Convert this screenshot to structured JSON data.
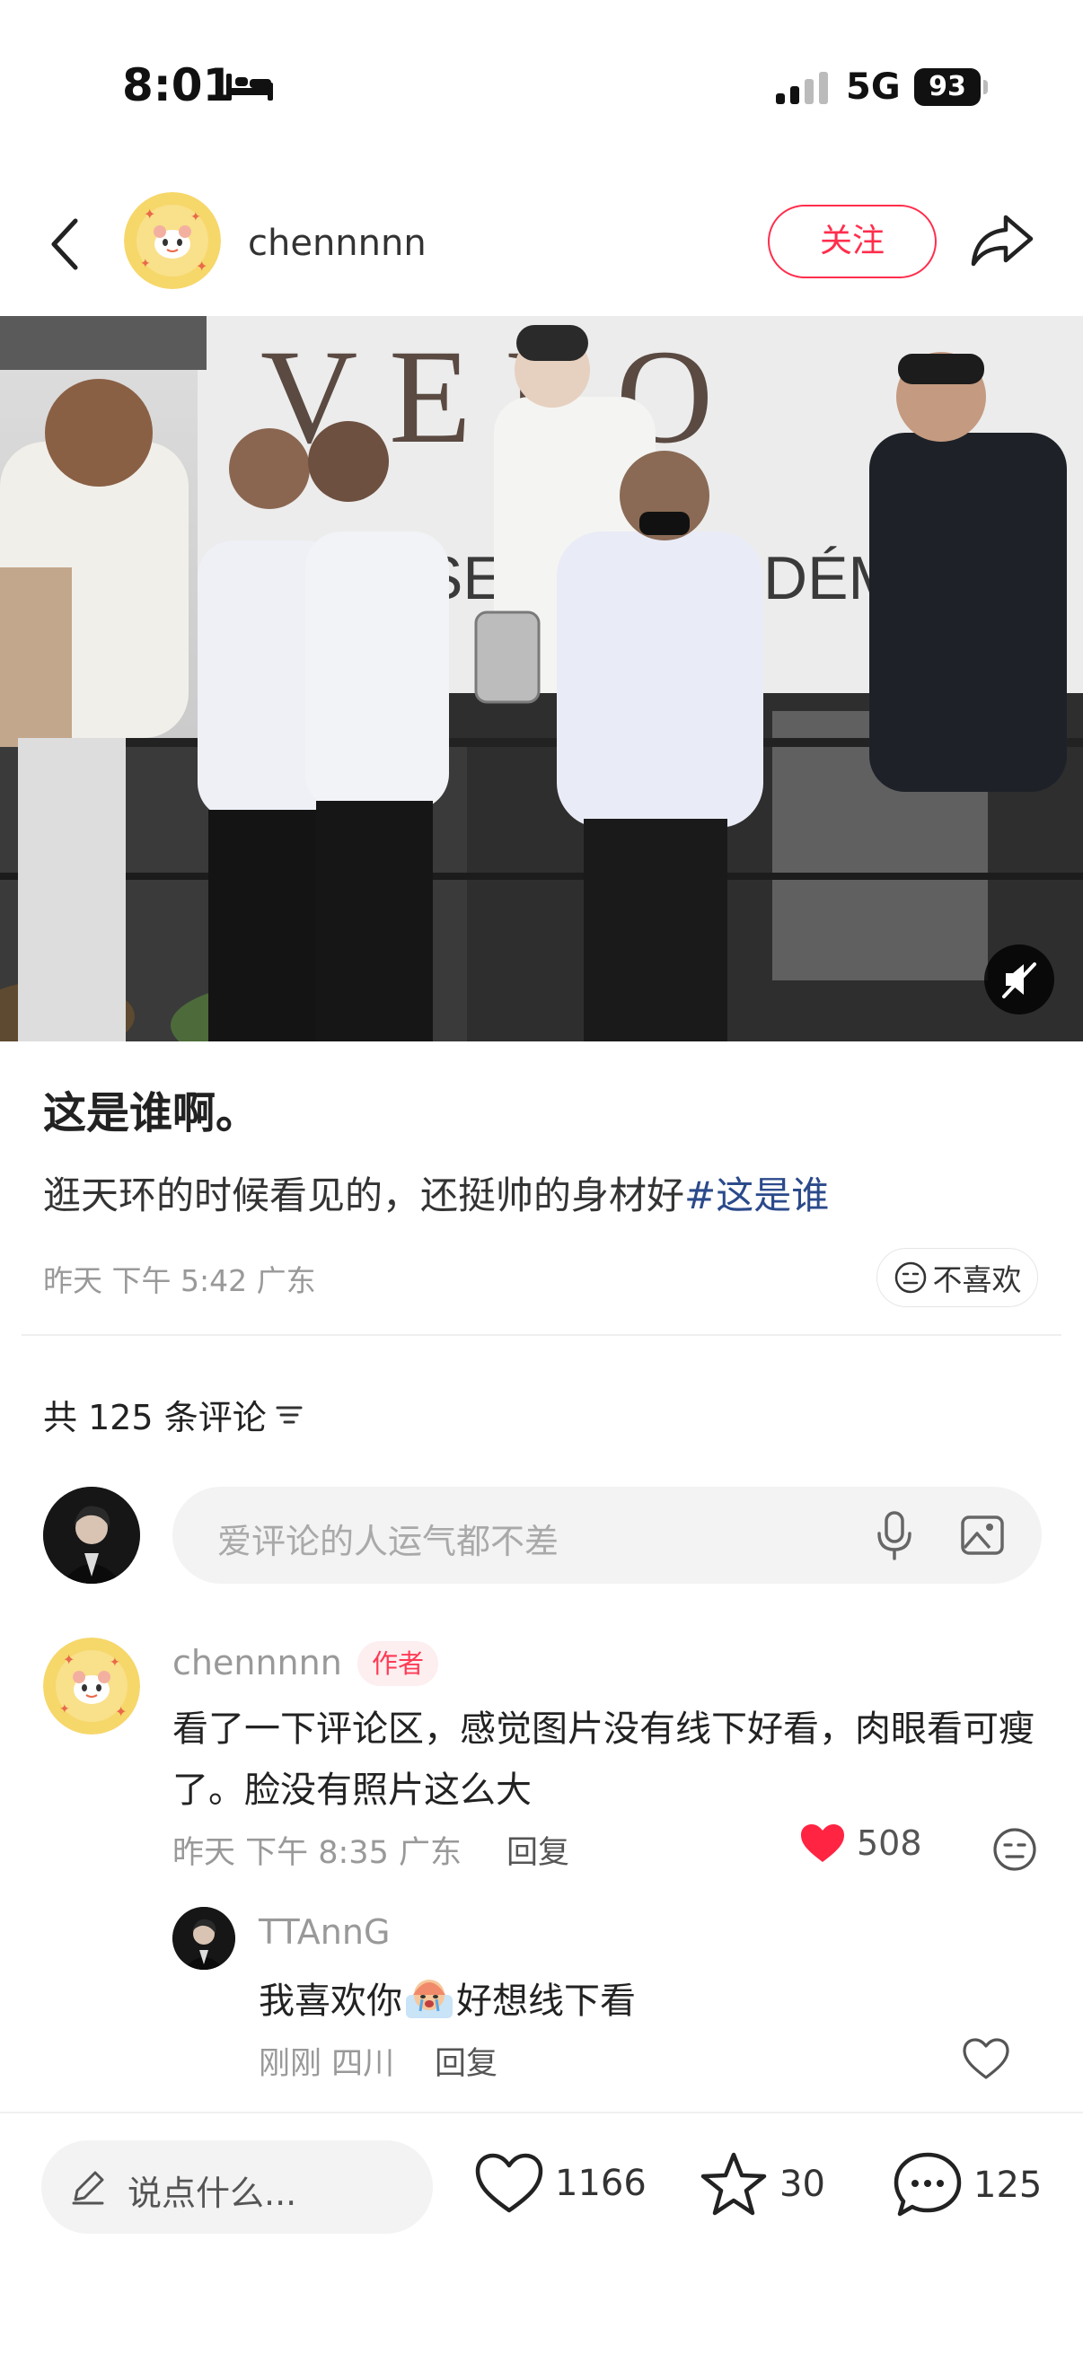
{
  "status_bar": {
    "time": "8:01",
    "network": "5G",
    "battery": "93"
  },
  "header": {
    "username": "chennnnn",
    "follow_label": "关注"
  },
  "post": {
    "title": "这是谁啊。",
    "body": "逛天环的时候看见的，还挺帅的身材好",
    "hashtag": "#这是谁",
    "meta": "昨天 下午 5:42 广东",
    "dislike_label": "不喜欢"
  },
  "comments_header": {
    "count_label": "共 125 条评论"
  },
  "comment_input": {
    "placeholder": "爱评论的人运气都不差"
  },
  "comments": [
    {
      "username": "chennnnn",
      "badge": "作者",
      "text": "看了一下评论区，感觉图片没有线下好看，肉眼看可瘦了。脸没有照片这么大",
      "meta": "昨天 下午 8:35 广东",
      "reply_label": "回复",
      "likes": "508",
      "liked": true,
      "replies": [
        {
          "username": "TTAnnG",
          "text_before": "我喜欢你",
          "emoji": "crying-face-emoji",
          "text_after": "好想线下看",
          "meta": "刚刚 四川",
          "reply_label": "回复"
        }
      ]
    }
  ],
  "bottom_bar": {
    "input_placeholder": "说点什么...",
    "likes": "1166",
    "collects": "30",
    "comments": "125"
  },
  "colors": {
    "brand_red": "#ff2e4d",
    "hashtag_blue": "#2b4a8b",
    "like_red": "#ff2442"
  }
}
